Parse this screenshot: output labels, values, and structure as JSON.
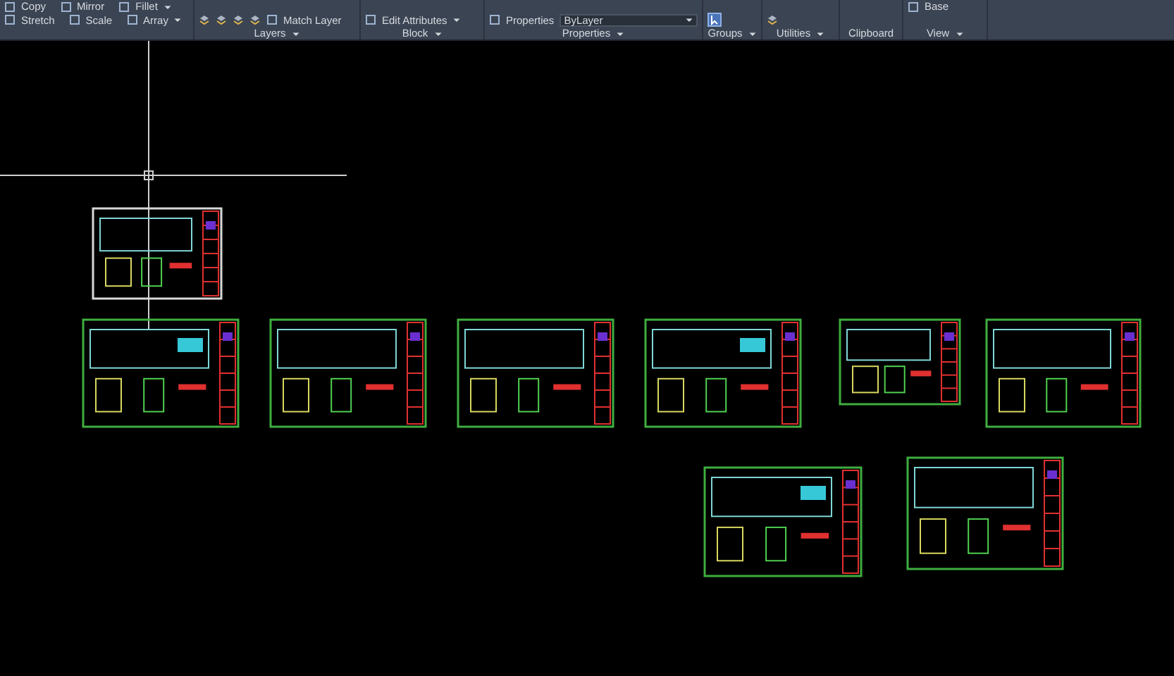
{
  "ribbon": {
    "panels": [
      {
        "rows": [
          [
            {
              "kind": "tool",
              "label": "Copy"
            },
            {
              "kind": "tool",
              "label": "Mirror"
            },
            {
              "kind": "tool",
              "label": "Fillet",
              "dropdown": true
            }
          ],
          [
            {
              "kind": "tool",
              "label": "Stretch"
            },
            {
              "kind": "tool",
              "label": "Scale"
            },
            {
              "kind": "tool",
              "label": "Array",
              "dropdown": true
            }
          ]
        ]
      },
      {
        "title": "Layers",
        "dropdown": true,
        "rows": [
          [],
          [
            {
              "kind": "icon"
            },
            {
              "kind": "icon"
            },
            {
              "kind": "icon"
            },
            {
              "kind": "icon"
            },
            {
              "kind": "tool",
              "label": "Match Layer"
            }
          ]
        ]
      },
      {
        "title": "Block",
        "dropdown": true,
        "rows": [
          [],
          [
            {
              "kind": "tool",
              "label": "Edit Attributes",
              "dropdown": true
            }
          ]
        ]
      },
      {
        "title": "Properties",
        "dropdown": true,
        "rows": [
          [],
          [
            {
              "kind": "tool",
              "label": "Properties"
            },
            {
              "kind": "combo",
              "label": "ByLayer"
            }
          ]
        ]
      },
      {
        "title": "Groups",
        "dropdown": true,
        "rows": [
          [],
          [
            {
              "kind": "toggle",
              "on": true
            }
          ]
        ]
      },
      {
        "title": "Utilities",
        "dropdown": true,
        "rows": [
          [],
          [
            {
              "kind": "icon"
            }
          ]
        ]
      },
      {
        "title": "Clipboard",
        "rows": [
          [],
          []
        ]
      },
      {
        "title": "View",
        "dropdown": true,
        "rows": [
          [
            {
              "kind": "tool",
              "label": "Base"
            }
          ],
          []
        ]
      }
    ]
  }
}
